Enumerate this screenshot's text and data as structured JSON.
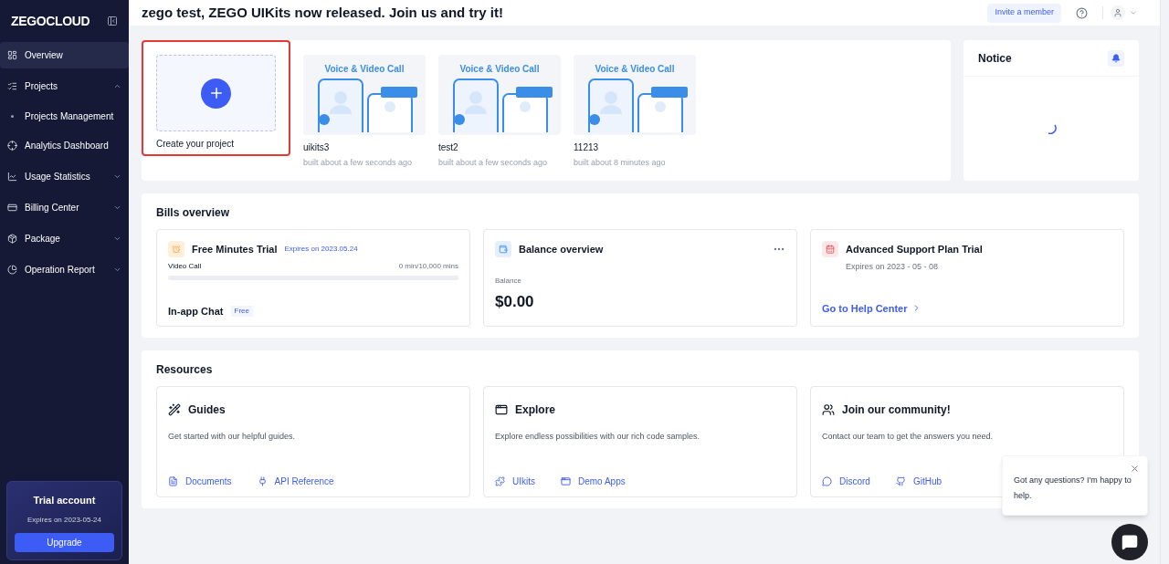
{
  "sidebar": {
    "logo": "ZEGOCLOUD",
    "items": [
      {
        "label": "Overview",
        "kind": "item",
        "selected": true
      },
      {
        "label": "Projects",
        "kind": "group",
        "selected": false,
        "expanded": true,
        "children": [
          {
            "label": "Projects Management",
            "selected": false
          }
        ]
      },
      {
        "label": "Analytics Dashboard",
        "kind": "item",
        "selected": false
      },
      {
        "label": "Usage Statistics",
        "kind": "group",
        "selected": false,
        "expanded": false
      },
      {
        "label": "Billing Center",
        "kind": "group",
        "selected": false,
        "expanded": false
      },
      {
        "label": "Package",
        "kind": "group",
        "selected": false,
        "expanded": false
      },
      {
        "label": "Operation Report",
        "kind": "group",
        "selected": false,
        "expanded": false
      }
    ],
    "trial": {
      "title": "Trial account",
      "expires": "Expires on 2023-05-24",
      "button": "Upgrade"
    }
  },
  "header": {
    "title": "zego test, ZEGO UIKits now released. Join us and try it!",
    "invite_button": "Invite a member"
  },
  "projects": {
    "create_label": "Create your project",
    "items": [
      {
        "thumbnail_title": "Voice & Video Call",
        "name": "uikits3",
        "built": "built about a few seconds ago"
      },
      {
        "thumbnail_title": "Voice & Video Call",
        "name": "test2",
        "built": "built about a few seconds ago"
      },
      {
        "thumbnail_title": "Voice & Video Call",
        "name": "11213",
        "built": "built about 8 minutes ago"
      }
    ]
  },
  "notice": {
    "title": "Notice"
  },
  "bills": {
    "title": "Bills overview",
    "free_trial": {
      "title": "Free Minutes Trial",
      "expires": "Expires on 2023.05.24",
      "meter_label": "Video Call",
      "reading": "0 min/10,000 mins",
      "level": 0,
      "chat_label": "In-app Chat",
      "chat_tag": "Free"
    },
    "balance": {
      "title": "Balance overview",
      "label": "Balance",
      "amount": "$0.00"
    },
    "support": {
      "title": "Advanced Support Plan Trial",
      "expires": "Expires on 2023 - 05 - 08",
      "link": "Go to Help Center"
    }
  },
  "resources": {
    "title": "Resources",
    "cards": [
      {
        "kind": "guides",
        "title": "Guides",
        "text": "Get started with our helpful guides.",
        "links": [
          {
            "kind": "doc",
            "label": "Documents"
          },
          {
            "kind": "api",
            "label": "API Reference"
          }
        ]
      },
      {
        "kind": "explore",
        "title": "Explore",
        "text": "Explore endless possibilities with our rich code samples.",
        "links": [
          {
            "kind": "puzzle",
            "label": "UIkits"
          },
          {
            "kind": "apps",
            "label": "Demo Apps"
          }
        ]
      },
      {
        "kind": "community",
        "title": "Join our community!",
        "text": "Contact our team to get the answers you need.",
        "links": [
          {
            "kind": "discord",
            "label": "Discord"
          },
          {
            "kind": "github",
            "label": "GitHub"
          }
        ]
      }
    ]
  },
  "chat_popup": {
    "text": "Got any questions? I'm happy to help."
  }
}
